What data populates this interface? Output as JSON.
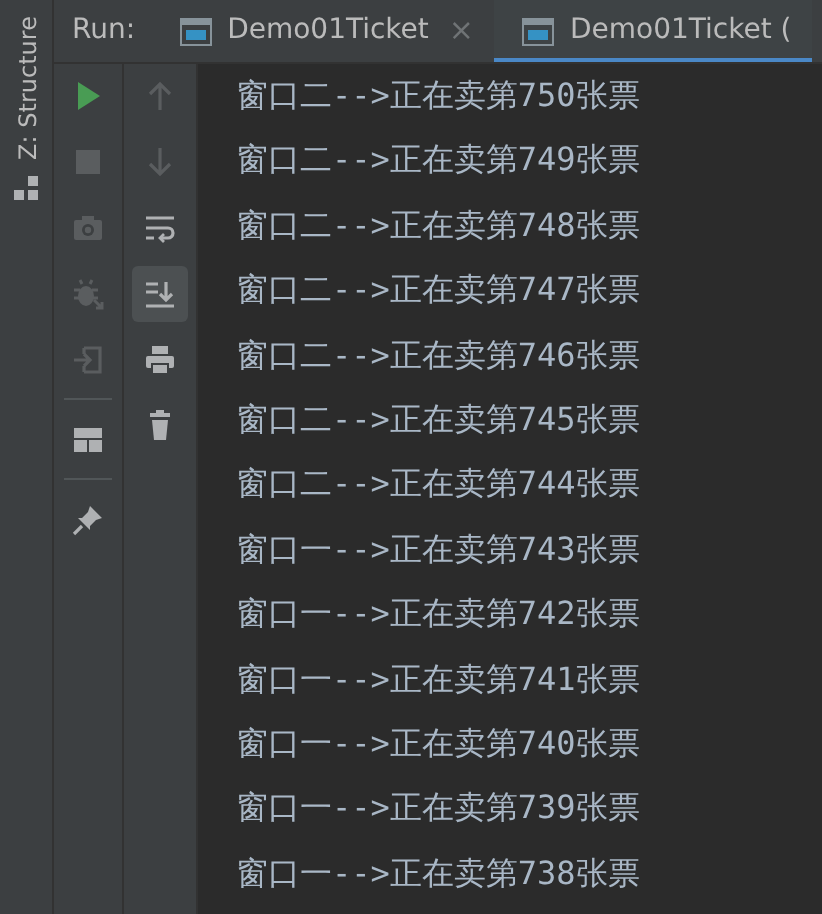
{
  "side_strip": {
    "label": "Z: Structure"
  },
  "run_bar": {
    "label": "Run:",
    "tabs": [
      {
        "title": "Demo01Ticket",
        "close": "×",
        "selected": false
      },
      {
        "title": "Demo01Ticket (",
        "selected": true
      }
    ]
  },
  "toolbar_left": [
    {
      "disabled": false
    },
    {
      "disabled": true
    },
    {
      "disabled": true
    },
    {
      "disabled": true
    },
    {
      "disabled": true
    },
    {
      "disabled": false
    },
    {
      "disabled": false
    }
  ],
  "toolbar_right": [
    {
      "disabled": true,
      "selected": false
    },
    {
      "disabled": true,
      "selected": false
    },
    {
      "disabled": false,
      "selected": false
    },
    {
      "disabled": false,
      "selected": true
    },
    {
      "disabled": false,
      "selected": false
    },
    {
      "disabled": false,
      "selected": false
    }
  ],
  "console": {
    "lines": [
      "窗口二-->正在卖第750张票",
      "窗口二-->正在卖第749张票",
      "窗口二-->正在卖第748张票",
      "窗口二-->正在卖第747张票",
      "窗口二-->正在卖第746张票",
      "窗口二-->正在卖第745张票",
      "窗口二-->正在卖第744张票",
      "窗口一-->正在卖第743张票",
      "窗口一-->正在卖第742张票",
      "窗口一-->正在卖第741张票",
      "窗口一-->正在卖第740张票",
      "窗口一-->正在卖第739张票",
      "窗口一-->正在卖第738张票"
    ]
  }
}
